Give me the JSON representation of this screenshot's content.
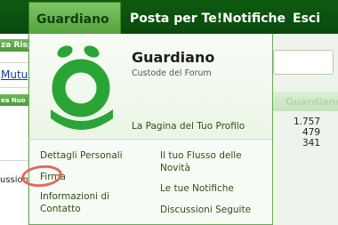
{
  "nav": {
    "items": [
      {
        "label": "Guardiano"
      },
      {
        "label": "Posta per Te!"
      },
      {
        "label": "Notifiche"
      },
      {
        "label": "Esci"
      }
    ]
  },
  "background": {
    "strip1": "za Risp",
    "link": "Mutuo",
    "strip2": "ea Nuo",
    "text": "ussioni",
    "right_header": "Guardiano",
    "stats": [
      "1.757",
      "479",
      "341"
    ]
  },
  "dropdown": {
    "title": "Guardiano",
    "subtitle": "Custode del Forum",
    "profile_link": "La Pagina del Tuo Profilo",
    "left_links": [
      "Dettagli Personali",
      "Firma",
      "Informazioni di Contatto"
    ],
    "right_links": [
      "Il tuo Flusso delle Novità",
      "Le tue Notifiche",
      "Discussioni Seguite"
    ]
  },
  "colors": {
    "nav_bg": "#0e5a11",
    "active_tab": "#6bb552",
    "logo_green": "#2aa535",
    "highlight": "#e0695f"
  }
}
